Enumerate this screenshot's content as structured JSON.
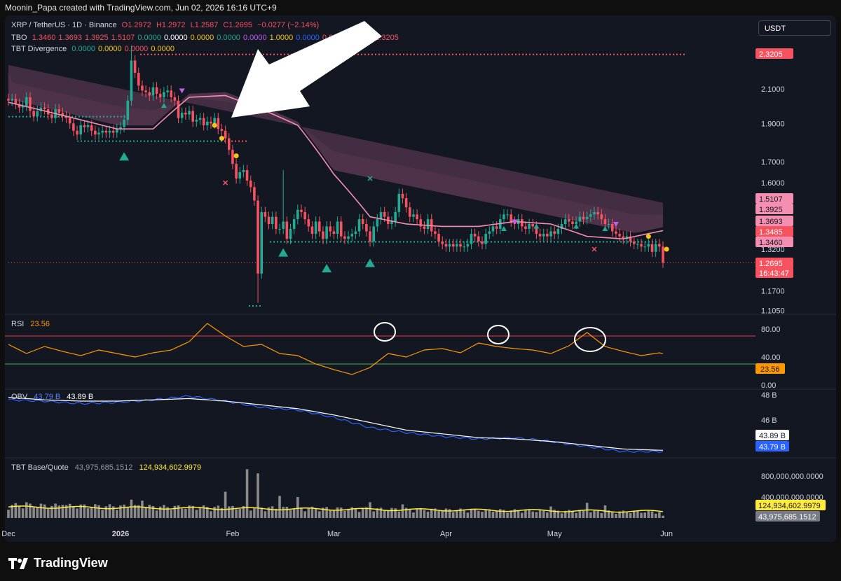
{
  "header": {
    "title": "Moonin_Papa created with TradingView.com, Jun 02, 2026 16:16 UTC+9"
  },
  "legend": {
    "symbol": "XRP / TetherUS · 1D · Binance",
    "ohlc": {
      "o": "O1.2972",
      "h": "H1.2972",
      "l": "L1.2587",
      "c": "C1.2695",
      "chg": "−0.0277 (−2.14%)"
    },
    "tbo": {
      "name": "TBO",
      "values": [
        "1.3460",
        "1.3693",
        "1.3925",
        "1.5107",
        "0.0000",
        "0.0000",
        "0.0000",
        "0.0000",
        "0.0000",
        "1.0000",
        "0.0000",
        "0.0000",
        "1.3485",
        "2.3205"
      ],
      "colors": [
        "#f7525f",
        "#f7525f",
        "#f7525f",
        "#f7525f",
        "#22ab94",
        "#ffffff",
        "#f5c518",
        "#22ab94",
        "#c45ef0",
        "#f5c518",
        "#2962ff",
        "#f7525f",
        "#f7525f",
        "#f7525f"
      ]
    },
    "tbt_div": {
      "name": "TBT Divergence",
      "values": [
        "0.0000",
        "0.0000",
        "0.0000",
        "0.0000"
      ],
      "colors": [
        "#22ab94",
        "#f5c518",
        "#f7525f",
        "#f5c518"
      ]
    }
  },
  "currency": "USDT",
  "colors": {
    "up": "#22ab94",
    "down": "#f7525f",
    "ma": "#f48fb1",
    "rsi": "#ff9800",
    "obv": "#2962ff",
    "obv_ma": "#ffffff",
    "vol_ma": "#ffeb3b",
    "vol": "#8a8a8a"
  },
  "chart_data": [
    {
      "type": "candlestick",
      "pane": "price",
      "ylim": [
        1.1,
        2.35
      ],
      "yscale": "log",
      "y_ticks": [
        "2.1000",
        "1.9000",
        "1.7000",
        "1.6000",
        "1.3200",
        "1.1700",
        "1.1050"
      ],
      "x_ticks": [
        "Dec",
        "2026",
        "Feb",
        "Mar",
        "Apr",
        "May",
        "Jun"
      ],
      "x_tick_index": [
        0,
        31,
        62,
        90,
        121,
        151,
        182
      ],
      "close": [
        2.03,
        2.04,
        2.01,
        1.99,
        2.0,
        2.05,
        1.97,
        1.94,
        1.97,
        1.99,
        1.98,
        1.95,
        1.93,
        1.98,
        1.96,
        1.94,
        1.93,
        1.9,
        1.86,
        1.84,
        1.89,
        1.88,
        1.89,
        1.86,
        1.84,
        1.85,
        1.86,
        1.85,
        1.86,
        1.85,
        1.87,
        1.88,
        1.92,
        2.03,
        2.28,
        2.2,
        2.12,
        2.09,
        2.08,
        2.06,
        2.11,
        2.07,
        2.05,
        2.08,
        2.09,
        2.05,
        2.03,
        1.93,
        1.96,
        1.95,
        1.97,
        1.91,
        1.92,
        1.93,
        1.89,
        1.91,
        1.9,
        1.93,
        1.87,
        1.86,
        1.82,
        1.76,
        1.69,
        1.62,
        1.65,
        1.66,
        1.61,
        1.58,
        1.52,
        1.23,
        1.47,
        1.45,
        1.42,
        1.45,
        1.4,
        1.4,
        1.43,
        1.36,
        1.4,
        1.44,
        1.48,
        1.47,
        1.44,
        1.41,
        1.38,
        1.43,
        1.39,
        1.36,
        1.41,
        1.39,
        1.38,
        1.43,
        1.37,
        1.36,
        1.37,
        1.38,
        1.39,
        1.44,
        1.42,
        1.39,
        1.35,
        1.41,
        1.44,
        1.47,
        1.45,
        1.42,
        1.43,
        1.47,
        1.55,
        1.53,
        1.49,
        1.45,
        1.46,
        1.44,
        1.41,
        1.4,
        1.44,
        1.39,
        1.38,
        1.35,
        1.34,
        1.33,
        1.34,
        1.33,
        1.34,
        1.33,
        1.33,
        1.34,
        1.38,
        1.37,
        1.35,
        1.34,
        1.38,
        1.39,
        1.41,
        1.4,
        1.44,
        1.46,
        1.46,
        1.43,
        1.42,
        1.44,
        1.41,
        1.4,
        1.42,
        1.41,
        1.38,
        1.37,
        1.38,
        1.37,
        1.39,
        1.38,
        1.4,
        1.42,
        1.44,
        1.43,
        1.42,
        1.43,
        1.45,
        1.44,
        1.45,
        1.46,
        1.47,
        1.46,
        1.44,
        1.42,
        1.42,
        1.39,
        1.38,
        1.37,
        1.36,
        1.37,
        1.35,
        1.34,
        1.34,
        1.33,
        1.33,
        1.34,
        1.31,
        1.34,
        1.33,
        1.2695
      ],
      "ma": {
        "name": "",
        "values_sampled_every_10": [
          2.02,
          1.97,
          1.92,
          1.87,
          1.87,
          2.05,
          2.06,
          1.98,
          1.89,
          1.64,
          1.45,
          1.42,
          1.41,
          1.41,
          1.43,
          1.42,
          1.37,
          1.36,
          1.39,
          1.42,
          1.41,
          1.4,
          1.42,
          1.38,
          1.35
        ]
      },
      "horizontal_levels": [
        2.3205,
        1.938,
        1.805,
        1.3485,
        1.2695
      ],
      "price_labels": [
        {
          "value": "2.3205",
          "color": "#f7525f"
        },
        {
          "value": "1.5107",
          "color": "#f48fb1"
        },
        {
          "value": "1.3925",
          "color": "#f48fb1"
        },
        {
          "value": "1.3693",
          "color": "#f48fb1"
        },
        {
          "value": "1.3485",
          "color": "#f7525f"
        },
        {
          "value": "1.3460",
          "color": "#f48fb1"
        },
        {
          "value": "1.2695",
          "color": "#f7525f"
        },
        {
          "value": "16:43:47",
          "color": "#f7525f"
        }
      ]
    },
    {
      "type": "line",
      "pane": "rsi",
      "title": "RSI",
      "value_label": "23.56",
      "ylim": [
        0,
        100
      ],
      "y_ticks": [
        "80.00",
        "40.00",
        "0.00"
      ],
      "levels": [
        70,
        30
      ],
      "values_sampled_every_5": [
        58,
        45,
        55,
        48,
        42,
        50,
        45,
        40,
        46,
        50,
        62,
        88,
        70,
        55,
        58,
        45,
        42,
        30,
        22,
        15,
        25,
        45,
        40,
        50,
        52,
        46,
        60,
        55,
        52,
        50,
        45,
        56,
        75,
        55,
        48,
        42,
        46,
        40,
        52,
        45,
        58,
        70,
        52,
        60,
        50,
        48,
        42,
        55,
        60,
        70,
        46,
        55,
        62,
        42,
        70,
        78,
        65,
        50,
        40,
        45,
        42,
        40,
        46,
        38,
        35,
        30,
        24
      ]
    },
    {
      "type": "line",
      "pane": "obv",
      "title": "OBV",
      "series": [
        {
          "name": "",
          "color": "#2962ff",
          "last": "43.79 B"
        },
        {
          "name": "",
          "color": "#ffffff",
          "last": "43.89 B"
        }
      ],
      "y_ticks": [
        "48 B",
        "46 B"
      ],
      "ylim": [
        42.5,
        48.5
      ],
      "obv_values_sampled_every_10": [
        47.6,
        47.5,
        47.3,
        47.4,
        47.6,
        47.9,
        47.5,
        47.0,
        46.8,
        46.2,
        45.4,
        45.0,
        44.7,
        44.5,
        44.6,
        44.3,
        43.9,
        43.5,
        43.5,
        43.6,
        43.8,
        43.9,
        43.8,
        43.9,
        43.79
      ],
      "ma_values_sampled_every_10": [
        47.8,
        47.6,
        47.5,
        47.5,
        47.6,
        47.7,
        47.5,
        47.2,
        46.9,
        46.4,
        45.8,
        45.2,
        44.9,
        44.6,
        44.5,
        44.3,
        44.0,
        43.7,
        43.6,
        43.6,
        43.7,
        43.8,
        43.85,
        43.88,
        43.89
      ]
    },
    {
      "type": "bar",
      "pane": "volume",
      "title": "TBT Base/Quote",
      "value_labels": [
        "43,975,685.1512",
        "124,934,602.9979"
      ],
      "y_ticks": [
        "800,000,000.0000",
        "400,000,000.0000"
      ],
      "ylim": [
        0,
        1000000000
      ],
      "ma_value": 124934602.9979,
      "last_value": 43975685.1512,
      "spike_indices_and_values": [
        [
          5,
          300000000
        ],
        [
          15,
          250000000
        ],
        [
          34,
          350000000
        ],
        [
          37,
          330000000
        ],
        [
          60,
          500000000
        ],
        [
          66,
          930000000
        ],
        [
          69,
          850000000
        ],
        [
          75,
          420000000
        ],
        [
          80,
          400000000
        ],
        [
          100,
          300000000
        ],
        [
          109,
          260000000
        ],
        [
          150,
          220000000
        ],
        [
          160,
          290000000
        ],
        [
          165,
          240000000
        ]
      ]
    }
  ],
  "pane_labels": {
    "rsi": "RSI",
    "rsi_value": "23.56",
    "obv": "OBV",
    "obv_val1": "43.79 B",
    "obv_val2": "43.89 B",
    "vol": "TBT Base/Quote",
    "vol_val1": "43,975,685.1512",
    "vol_val2": "124,934,602.9979"
  },
  "brand": "TradingView"
}
